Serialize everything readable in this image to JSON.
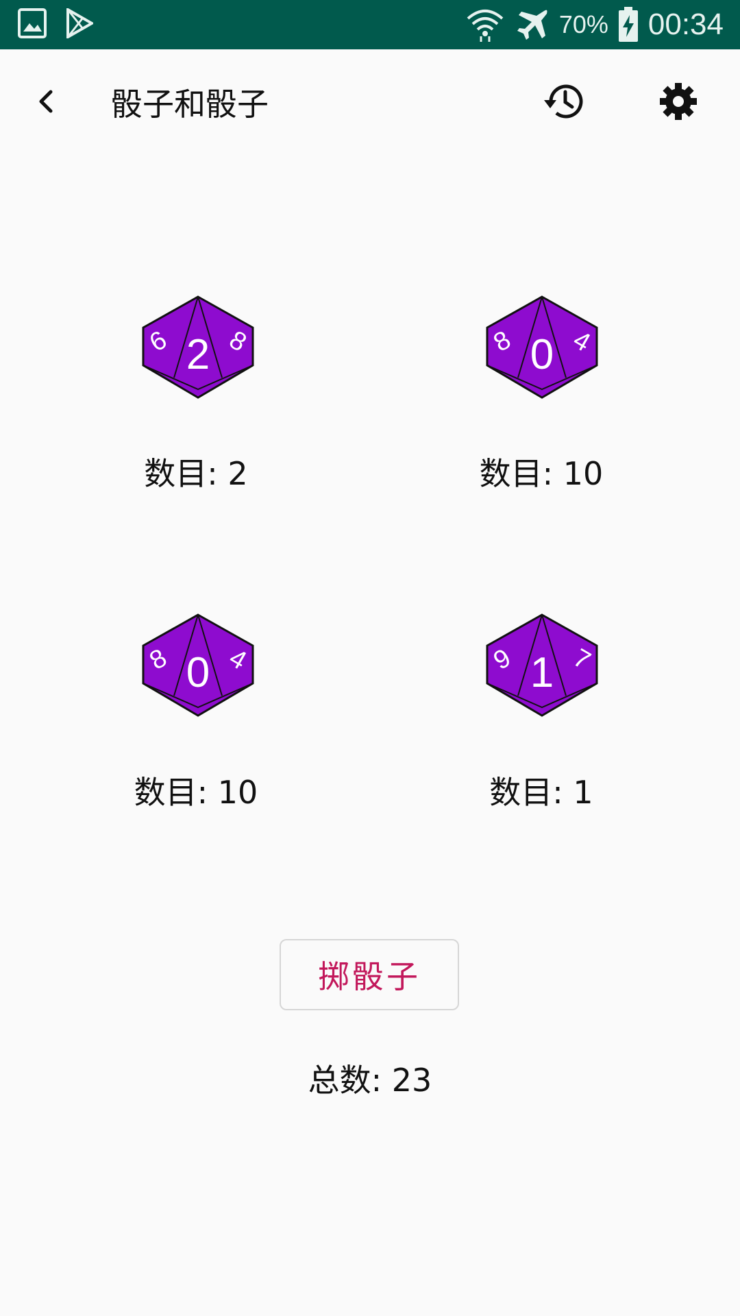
{
  "status_bar": {
    "battery_percent": "70%",
    "time": "00:34",
    "icons": [
      "gallery-icon",
      "play-store-icon",
      "wifi-icon",
      "airplane-mode-icon",
      "battery-charging-icon"
    ]
  },
  "app_bar": {
    "title": "骰子和骰子",
    "icons": [
      "back-icon",
      "history-icon",
      "settings-icon"
    ]
  },
  "dice": [
    {
      "center_face": "2",
      "left_face": "6",
      "right_face": "8",
      "label": "数目: 2"
    },
    {
      "center_face": "0",
      "left_face": "8",
      "right_face": "4",
      "label": "数目: 10"
    },
    {
      "center_face": "0",
      "left_face": "8",
      "right_face": "4",
      "label": "数目: 10"
    },
    {
      "center_face": "1",
      "left_face": "9",
      "right_face": "7",
      "label": "数目: 1"
    }
  ],
  "roll_button_label": "掷骰子",
  "total_label": "总数: 23",
  "colors": {
    "status_bar": "#015a4d",
    "die_fill": "#8e0ccf",
    "accent_text": "#c2185b"
  }
}
